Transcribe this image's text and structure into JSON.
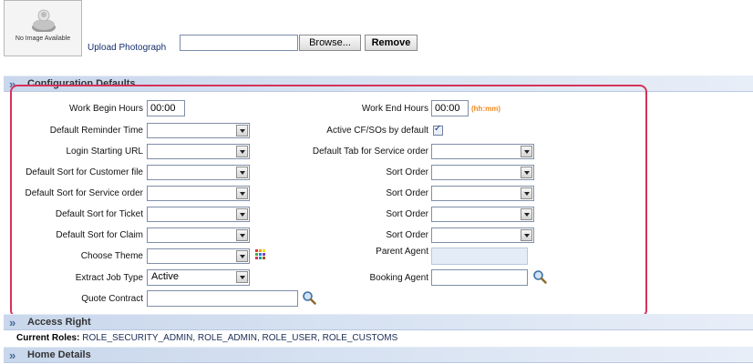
{
  "photo": {
    "caption": "No Image Available",
    "upload_label": "Upload Photograph",
    "browse_label": "Browse...",
    "remove_label": "Remove"
  },
  "sections": {
    "config": "Configuration Defaults",
    "access": "Access Right",
    "home": "Home Details"
  },
  "form": {
    "work_begin_label": "Work Begin Hours",
    "work_begin_value": "00:00",
    "work_end_label": "Work End Hours",
    "work_end_value": "00:00",
    "time_hint": "(hh:mm)",
    "reminder_label": "Default Reminder Time",
    "active_cf_label": "Active CF/SOs by default",
    "active_cf_checked": true,
    "login_url_label": "Login Starting URL",
    "default_tab_label": "Default Tab for Service order",
    "sort_customer_label": "Default Sort for Customer file",
    "sort_service_label": "Default Sort for Service order",
    "sort_ticket_label": "Default Sort for Ticket",
    "sort_claim_label": "Default Sort for Claim",
    "sort_order_label": "Sort Order",
    "theme_label": "Choose Theme",
    "parent_agent_label": "Parent Agent",
    "extract_job_label": "Extract Job Type",
    "extract_job_value": "Active",
    "booking_agent_label": "Booking Agent",
    "quote_contract_label": "Quote Contract"
  },
  "access": {
    "roles_prefix": "Current Roles:",
    "roles_value": "ROLE_SECURITY_ADMIN, ROLE_ADMIN, ROLE_USER, ROLE_CUSTOMS"
  },
  "colors": {
    "highlight": "#d6325a",
    "hint": "#f08a1c",
    "section_bar": "#c9d7ec"
  },
  "icons": [
    "person-icon",
    "theme-palette-icon",
    "search-icon",
    "chevron-icon"
  ]
}
